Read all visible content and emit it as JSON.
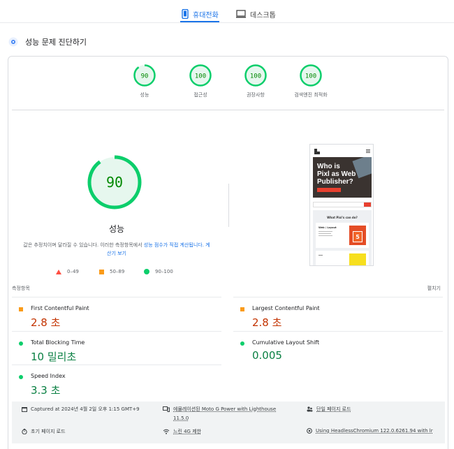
{
  "tabs": [
    {
      "label": "휴대전화",
      "active": true,
      "icon": "smartphone-icon"
    },
    {
      "label": "데스크톱",
      "active": false,
      "icon": "desktop-icon"
    }
  ],
  "header": {
    "title": "성능 문제 진단하기",
    "icon": "diagnose-icon"
  },
  "categories": [
    {
      "score": "90",
      "label": "성능",
      "color": "#0cce6b",
      "fraction": 0.9
    },
    {
      "score": "100",
      "label": "접근성",
      "color": "#0cce6b",
      "fraction": 1.0
    },
    {
      "score": "100",
      "label": "권장사항",
      "color": "#0cce6b",
      "fraction": 1.0
    },
    {
      "score": "100",
      "label": "검색엔진 최적화",
      "color": "#0cce6b",
      "fraction": 1.0
    }
  ],
  "performance": {
    "score": "90",
    "fraction": 0.9,
    "label": "성능",
    "desc_start": "값은 추정치이며 달라질 수 있습니다. 이러한 측정항목에서 ",
    "desc_link1": "성능 점수가 직접 계산됩니다.",
    "desc_link2": "계산기 보기"
  },
  "legend": [
    {
      "range": "0–49",
      "color": "#ff4e42",
      "shape": "triangle"
    },
    {
      "range": "50–89",
      "color": "#fa9b19",
      "shape": "square"
    },
    {
      "range": "90–100",
      "color": "#0cce6b",
      "shape": "circle"
    }
  ],
  "preview": {
    "hero_line1": "Who is",
    "hero_line2": "Pixl as Web",
    "hero_line3": "Publisher?",
    "section_title": "What Pixl's can do?",
    "card1_title": "Web / Layout"
  },
  "metrics_section": {
    "label": "측정항목",
    "expand": "펼치기"
  },
  "metrics": [
    {
      "name": "First Contentful Paint",
      "value": "2.8 초",
      "rating": "orange"
    },
    {
      "name": "Largest Contentful Paint",
      "value": "2.8 초",
      "rating": "orange"
    },
    {
      "name": "Total Blocking Time",
      "value": "10 밀리초",
      "rating": "green"
    },
    {
      "name": "Cumulative Layout Shift",
      "value": "0.005",
      "rating": "green"
    },
    {
      "name": "Speed Index",
      "value": "3.3 초",
      "rating": "green"
    }
  ],
  "info": {
    "captured": "Captured at 2024년 4월 2일 오후 1:15 GMT+9",
    "device_line1": "에뮬레이션된 Moto G Power with Lighthouse",
    "device_line2": "11.5.0",
    "page_load": "단일 페이지 로드",
    "initial_load": "초기 페이지 로드",
    "throttling": "느린 4G 제한",
    "browser": "Using HeadlessChromium 122.0.6261.94 with lr"
  }
}
